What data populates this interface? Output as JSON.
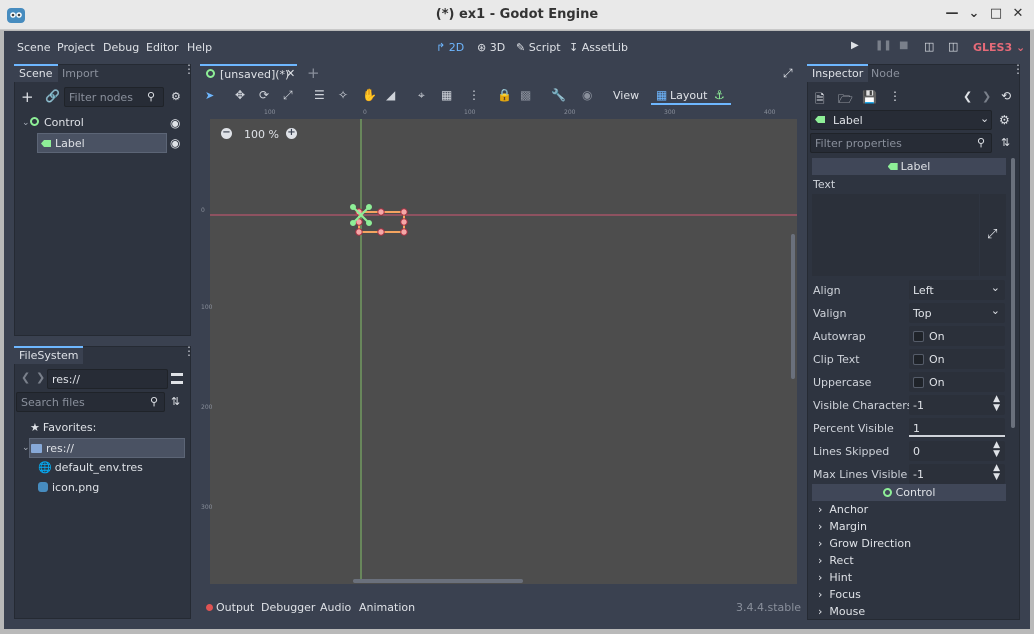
{
  "window": {
    "title": "(*) ex1 - Godot Engine",
    "controls": [
      "minimize",
      "maximize",
      "close"
    ]
  },
  "menubar": {
    "menus": [
      "Scene",
      "Project",
      "Debug",
      "Editor",
      "Help"
    ],
    "workspaces": [
      "2D",
      "3D",
      "Script",
      "AssetLib"
    ],
    "active_workspace": "2D",
    "renderer": "GLES3"
  },
  "scene_dock": {
    "tabs": [
      "Scene",
      "Import"
    ],
    "filter_placeholder": "Filter nodes",
    "nodes": [
      {
        "name": "Control",
        "icon": "control-node-icon"
      },
      {
        "name": "Label",
        "icon": "label-node-icon",
        "selected": true
      }
    ]
  },
  "filesystem_dock": {
    "tab": "FileSystem",
    "path": "res://",
    "search_placeholder": "Search files",
    "favorites_label": "Favorites:",
    "items": [
      {
        "name": "res://",
        "icon": "folder-icon",
        "selected": true
      },
      {
        "name": "default_env.tres",
        "icon": "environment-icon"
      },
      {
        "name": "icon.png",
        "icon": "image-icon"
      }
    ]
  },
  "editor": {
    "scene_tab": "[unsaved](*)",
    "zoom": "100 %",
    "toolbar": {
      "view_label": "View",
      "layout_label": "Layout"
    },
    "ruler_labels": {
      "h": [
        "100",
        "0",
        "100",
        "200",
        "300",
        "400"
      ],
      "v": [
        "0",
        "100",
        "200",
        "300"
      ]
    }
  },
  "bottom_panel": {
    "tabs": [
      "Output",
      "Debugger",
      "Audio",
      "Animation"
    ],
    "version": "3.4.4.stable"
  },
  "inspector": {
    "tabs": [
      "Inspector",
      "Node"
    ],
    "object_name": "Label",
    "filter_placeholder": "Filter properties",
    "label_section": "Label",
    "text_label": "Text",
    "properties": [
      {
        "label": "Align",
        "value": "Left",
        "kind": "dropdown"
      },
      {
        "label": "Valign",
        "value": "Top",
        "kind": "dropdown"
      },
      {
        "label": "Autowrap",
        "value": "On",
        "kind": "checkbox"
      },
      {
        "label": "Clip Text",
        "value": "On",
        "kind": "checkbox"
      },
      {
        "label": "Uppercase",
        "value": "On",
        "kind": "checkbox"
      },
      {
        "label": "Visible Characters",
        "value": "-1",
        "kind": "spin"
      },
      {
        "label": "Percent Visible",
        "value": "1",
        "kind": "slider",
        "fraction": 1.0
      },
      {
        "label": "Lines Skipped",
        "value": "0",
        "kind": "spin"
      },
      {
        "label": "Max Lines Visible",
        "value": "-1",
        "kind": "spin"
      }
    ],
    "control_section": "Control",
    "control_groups": [
      "Anchor",
      "Margin",
      "Grow Direction",
      "Rect",
      "Hint",
      "Focus",
      "Mouse"
    ]
  },
  "colors": {
    "accent": "#6eb7ff",
    "node_green": "#8eef97",
    "gles_red": "#e66a78",
    "x_axis": "#e55b7a",
    "y_axis": "#8ed66e"
  }
}
